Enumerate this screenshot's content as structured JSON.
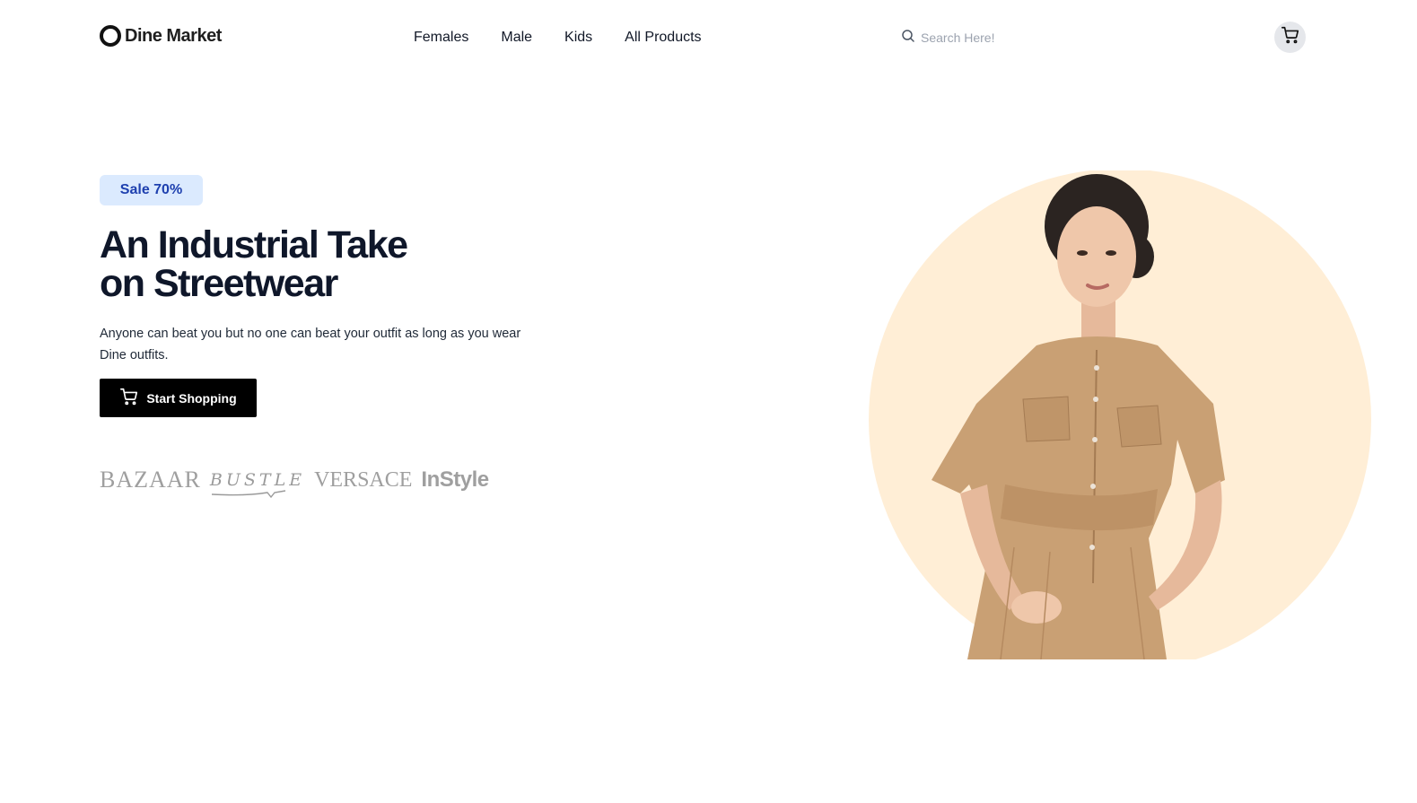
{
  "header": {
    "logo_text": "Dine Market",
    "nav": [
      {
        "label": "Females"
      },
      {
        "label": "Male"
      },
      {
        "label": "Kids"
      },
      {
        "label": "All Products"
      }
    ],
    "search": {
      "placeholder": "Search Here!",
      "value": ""
    },
    "cart_icon": "cart-icon"
  },
  "hero": {
    "badge": "Sale 70%",
    "headline_line1": "An Industrial Take",
    "headline_line2": "on Streetwear",
    "subtext": "Anyone can beat you but no one can beat your outfit as long as you wear Dine outfits.",
    "cta_label": "Start Shopping",
    "brands": [
      "BAZAAR",
      "BUSTLE",
      "VERSACE",
      "InStyle"
    ]
  },
  "colors": {
    "badge_bg": "#dbeafe",
    "badge_text": "#1e40af",
    "circle_bg": "#ffeed6",
    "dress": "#c9a074",
    "cta_bg": "#000000"
  }
}
